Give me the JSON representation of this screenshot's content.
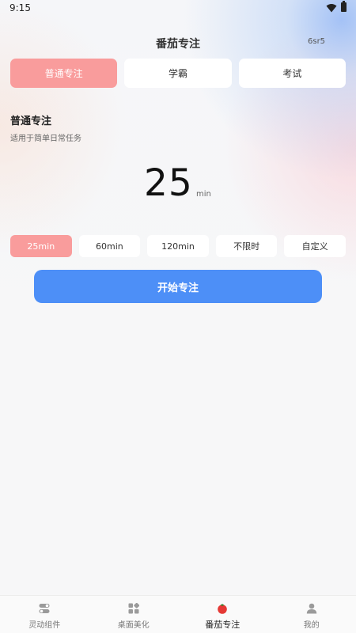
{
  "status_bar": {
    "time": "9:15"
  },
  "header": {
    "title": "番茄专注",
    "version": "6sr5"
  },
  "mode_tabs": [
    {
      "label": "普通专注",
      "active": true
    },
    {
      "label": "学霸",
      "active": false
    },
    {
      "label": "考试",
      "active": false
    }
  ],
  "mode_info": {
    "heading": "普通专注",
    "description": "适用于简单日常任务"
  },
  "timer": {
    "value": "25",
    "unit": "min"
  },
  "durations": [
    {
      "label": "25min",
      "active": true
    },
    {
      "label": "60min",
      "active": false
    },
    {
      "label": "120min",
      "active": false
    },
    {
      "label": "不限时",
      "active": false
    },
    {
      "label": "自定义",
      "active": false
    }
  ],
  "start_button": {
    "label": "开始专注"
  },
  "bottom_nav": [
    {
      "label": "灵动组件",
      "icon": "toggle-icon",
      "active": false
    },
    {
      "label": "桌面美化",
      "icon": "grid-icon",
      "active": false
    },
    {
      "label": "番茄专注",
      "icon": "tomato-icon",
      "active": true
    },
    {
      "label": "我的",
      "icon": "person-icon",
      "active": false
    }
  ],
  "colors": {
    "accent_pink": "#f99c9c",
    "primary_blue": "#4d8ff7",
    "tomato_red": "#e53935"
  }
}
